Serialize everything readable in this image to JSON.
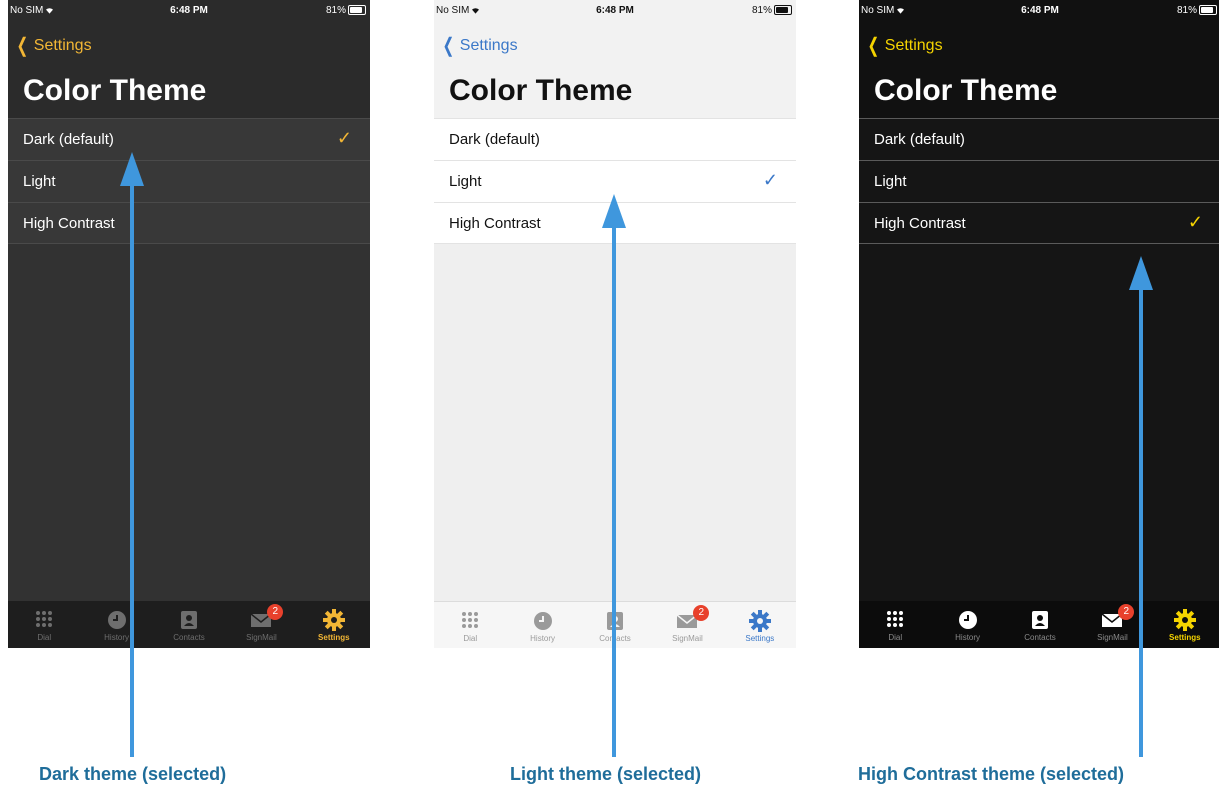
{
  "status_bar": {
    "carrier": "No SIM",
    "time": "6:48 PM",
    "battery": "81%"
  },
  "nav": {
    "back_label": "Settings"
  },
  "page_title": "Color Theme",
  "options": [
    "Dark (default)",
    "Light",
    "High Contrast"
  ],
  "check_glyph": "✓",
  "tabs": [
    {
      "label": "Dial",
      "icon": "keypad-icon"
    },
    {
      "label": "History",
      "icon": "clock-icon"
    },
    {
      "label": "Contacts",
      "icon": "contacts-book-icon"
    },
    {
      "label": "SignMail",
      "icon": "envelope-icon",
      "badge": "2"
    },
    {
      "label": "Settings",
      "icon": "gear-icon"
    }
  ],
  "screens": [
    {
      "theme": "Dark",
      "selected_index": 0,
      "caption": "Dark theme (selected)"
    },
    {
      "theme": "Light",
      "selected_index": 1,
      "caption": "Light theme (selected)"
    },
    {
      "theme": "High Contrast",
      "selected_index": 2,
      "caption": "High Contrast theme (selected)"
    }
  ],
  "colors": {
    "dark_accent": "#f2b635",
    "light_accent": "#3b78c8",
    "hc_accent": "#f5d300",
    "caption": "#1f6d9a",
    "arrow": "#3f97dd",
    "badge": "#e8412c"
  }
}
